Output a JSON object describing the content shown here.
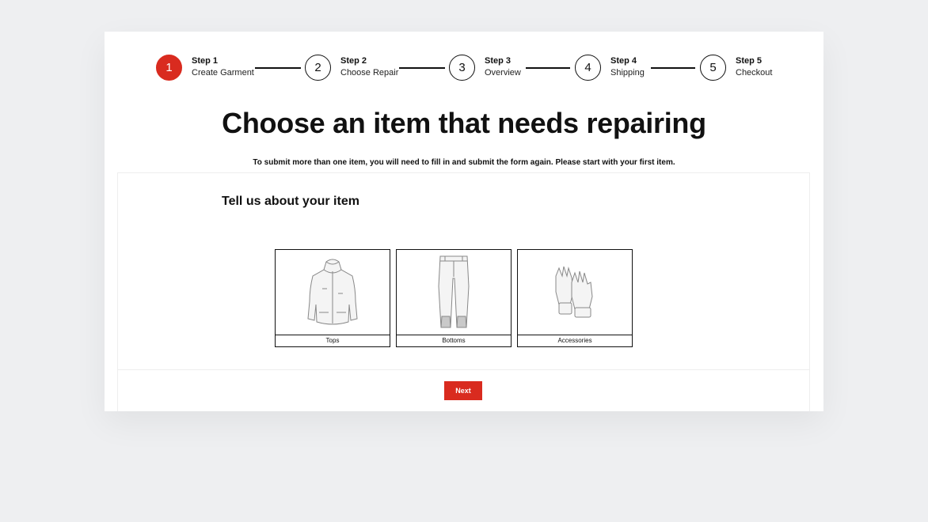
{
  "stepper": {
    "steps": [
      {
        "number": "1",
        "step_label": "Step 1",
        "name": "Create Garment"
      },
      {
        "number": "2",
        "step_label": "Step 2",
        "name": "Choose Repair"
      },
      {
        "number": "3",
        "step_label": "Step 3",
        "name": "Overview"
      },
      {
        "number": "4",
        "step_label": "Step 4",
        "name": "Shipping"
      },
      {
        "number": "5",
        "step_label": "Step 5",
        "name": "Checkout"
      }
    ],
    "active_step": 1
  },
  "page": {
    "title": "Choose an item that needs repairing",
    "note": "To submit more than one item, you will need to fill in and submit the form again. Please start with your first item."
  },
  "item_panel": {
    "title": "Tell us about your item",
    "items": [
      {
        "label": "Tops",
        "icon": "jacket-icon"
      },
      {
        "label": "Bottoms",
        "icon": "pants-icon"
      },
      {
        "label": "Accessories",
        "icon": "gloves-icon"
      }
    ]
  },
  "footer": {
    "next_label": "Next"
  },
  "colors": {
    "accent": "#d92b1f",
    "background": "#eeeff1"
  }
}
